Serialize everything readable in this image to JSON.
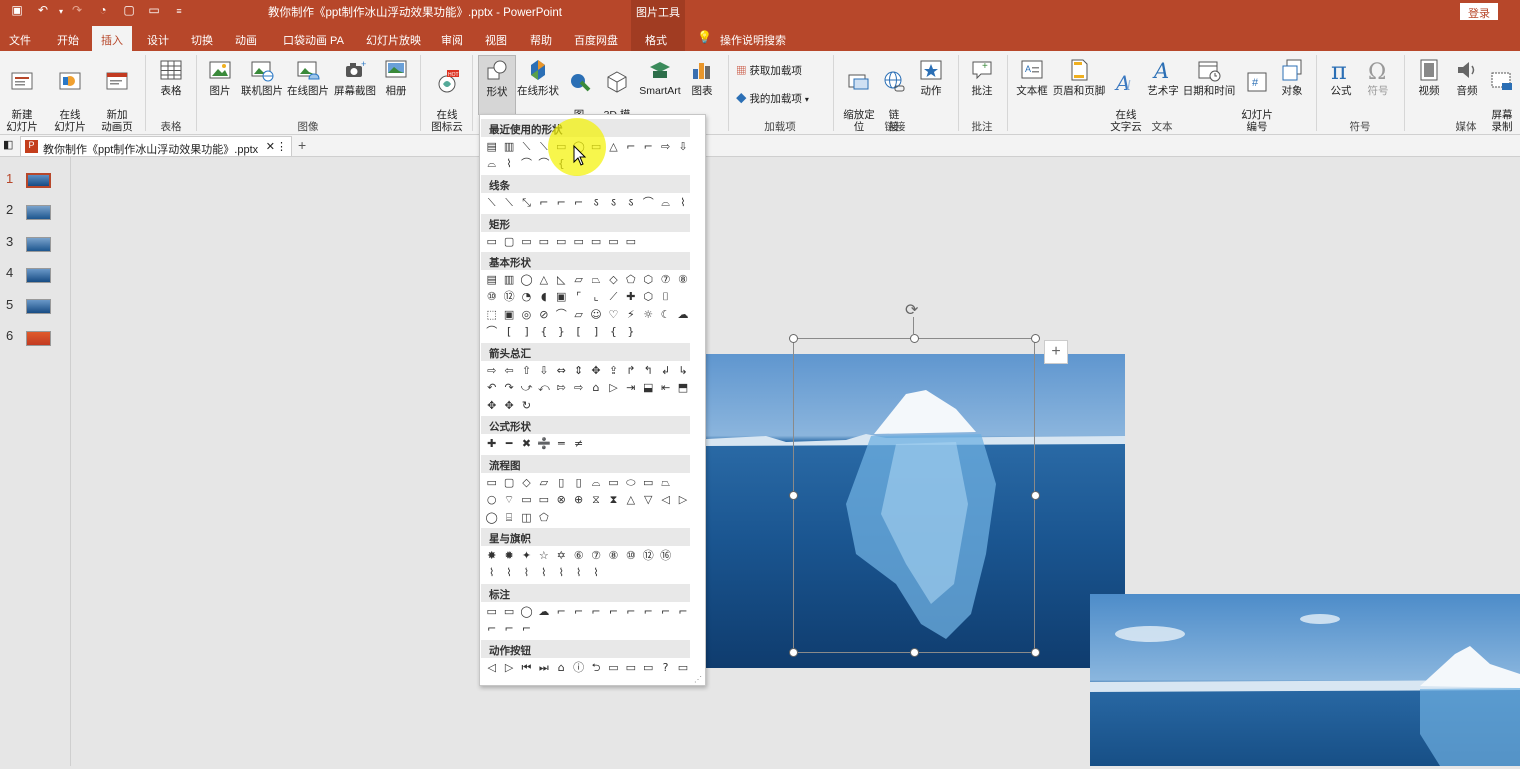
{
  "titlebar": {
    "doc_title": "教你制作《ppt制作冰山浮动效果功能》.pptx  -  PowerPoint",
    "picture_tools": "图片工具",
    "login": "登录"
  },
  "menu_tabs": [
    "文件",
    "开始",
    "插入",
    "设计",
    "切换",
    "动画",
    "口袋动画 PA",
    "幻灯片放映",
    "审阅",
    "视图",
    "帮助",
    "百度网盘",
    "格式"
  ],
  "tell_me": "操作说明搜索",
  "ribbon": {
    "new_slide": "新建\n幻灯片",
    "online_slide": "在线\n幻灯片",
    "new_anim_page": "新加\n动画页",
    "group_slides": "幻灯片",
    "table": "表格",
    "group_table": "表格",
    "picture": "图片",
    "online_picture": "联机图片",
    "online_pic2": "在线图片",
    "screenshot": "屏幕截图",
    "album": "相册",
    "group_images": "图像",
    "online_icon_cloud": "在线\n图标云",
    "shapes": "形状",
    "online_shapes": "在线形状",
    "icons": "图\n标",
    "model_3d": "3D 模\n型",
    "smartart": "SmartArt",
    "chart": "图表",
    "get_addins": "获取加载项",
    "my_addins": "我的加载项",
    "group_addins": "加载项",
    "zoom": "缩放定\n位",
    "link": "链\n接",
    "action": "动作",
    "group_links": "链接",
    "comment": "批注",
    "group_comments": "批注",
    "textbox": "文本框",
    "header_footer": "页眉和页脚",
    "online_text_cloud": "在线\n文字云",
    "wordart": "艺术字",
    "date_time": "日期和时间",
    "slide_number": "幻灯片\n编号",
    "object": "对象",
    "group_text": "文本",
    "equation": "公式",
    "symbol": "符号",
    "group_symbols": "符号",
    "video": "视频",
    "audio": "音频",
    "screen_record": "屏幕\n录制",
    "group_media": "媒体"
  },
  "file_tab": "教你制作《ppt制作冰山浮动效果功能》.pptx",
  "slides": [
    "1",
    "2",
    "3",
    "4",
    "5",
    "6"
  ],
  "shapes_dropdown": {
    "sections": [
      {
        "title": "最近使用的形状",
        "rows": [
          "▤▥⟍⟍▭◯▭△⌐⌐⇨⇩",
          "⌓⌇⌒⌒{"
        ]
      },
      {
        "title": "线条",
        "rows": [
          "⟍⟍⤡⌐⌐⌐ऽऽऽ⌒⌓⌇"
        ]
      },
      {
        "title": "矩形",
        "rows": [
          "▭▢▭▭▭▭▭▭▭"
        ]
      },
      {
        "title": "基本形状",
        "rows": [
          "▤▥◯△◺▱⏢◇⬠⬡⑦⑧",
          "⑩⑫◔◖▣⌜⌞⟋✚⬡⌷",
          "⬚▣◎⊘⌒▱☺♡⚡☼☾☁",
          "⌒[]{}[]{}"
        ]
      },
      {
        "title": "箭头总汇",
        "rows": [
          "⇨⇦⇧⇩⇔⇕✥⇪↱↰↲↳",
          "↶↷⤻⤺⇰⇨⌂▷⇥⬓⇤⬒",
          "✥✥↻"
        ]
      },
      {
        "title": "公式形状",
        "rows": [
          "✚━✖➗═≠"
        ]
      },
      {
        "title": "流程图",
        "rows": [
          "▭▢◇▱▯▯⌓▭⬭▭⏢",
          "○⌔▭▭⊗⊕⧖⧗△▽◁▷",
          "◯⌸◫⬠"
        ]
      },
      {
        "title": "星与旗帜",
        "rows": [
          "✸✹✦☆✡⑥⑦⑧⑩⑫⑯",
          "⌇⌇⌇⌇⌇⌇⌇"
        ]
      },
      {
        "title": "标注",
        "rows": [
          "▭▭◯☁⌐⌐⌐⌐⌐⌐⌐⌐",
          "⌐⌐⌐"
        ]
      },
      {
        "title": "动作按钮",
        "rows": [
          "◁▷⏮⏭⌂ⓘ⮌▭▭▭?▭"
        ]
      }
    ]
  },
  "colors": {
    "accent": "#b7472a",
    "ribbon_bg": "#f3f3f3",
    "canvas_bg": "#e6e6e6",
    "selection_hint": "#f4f200"
  }
}
